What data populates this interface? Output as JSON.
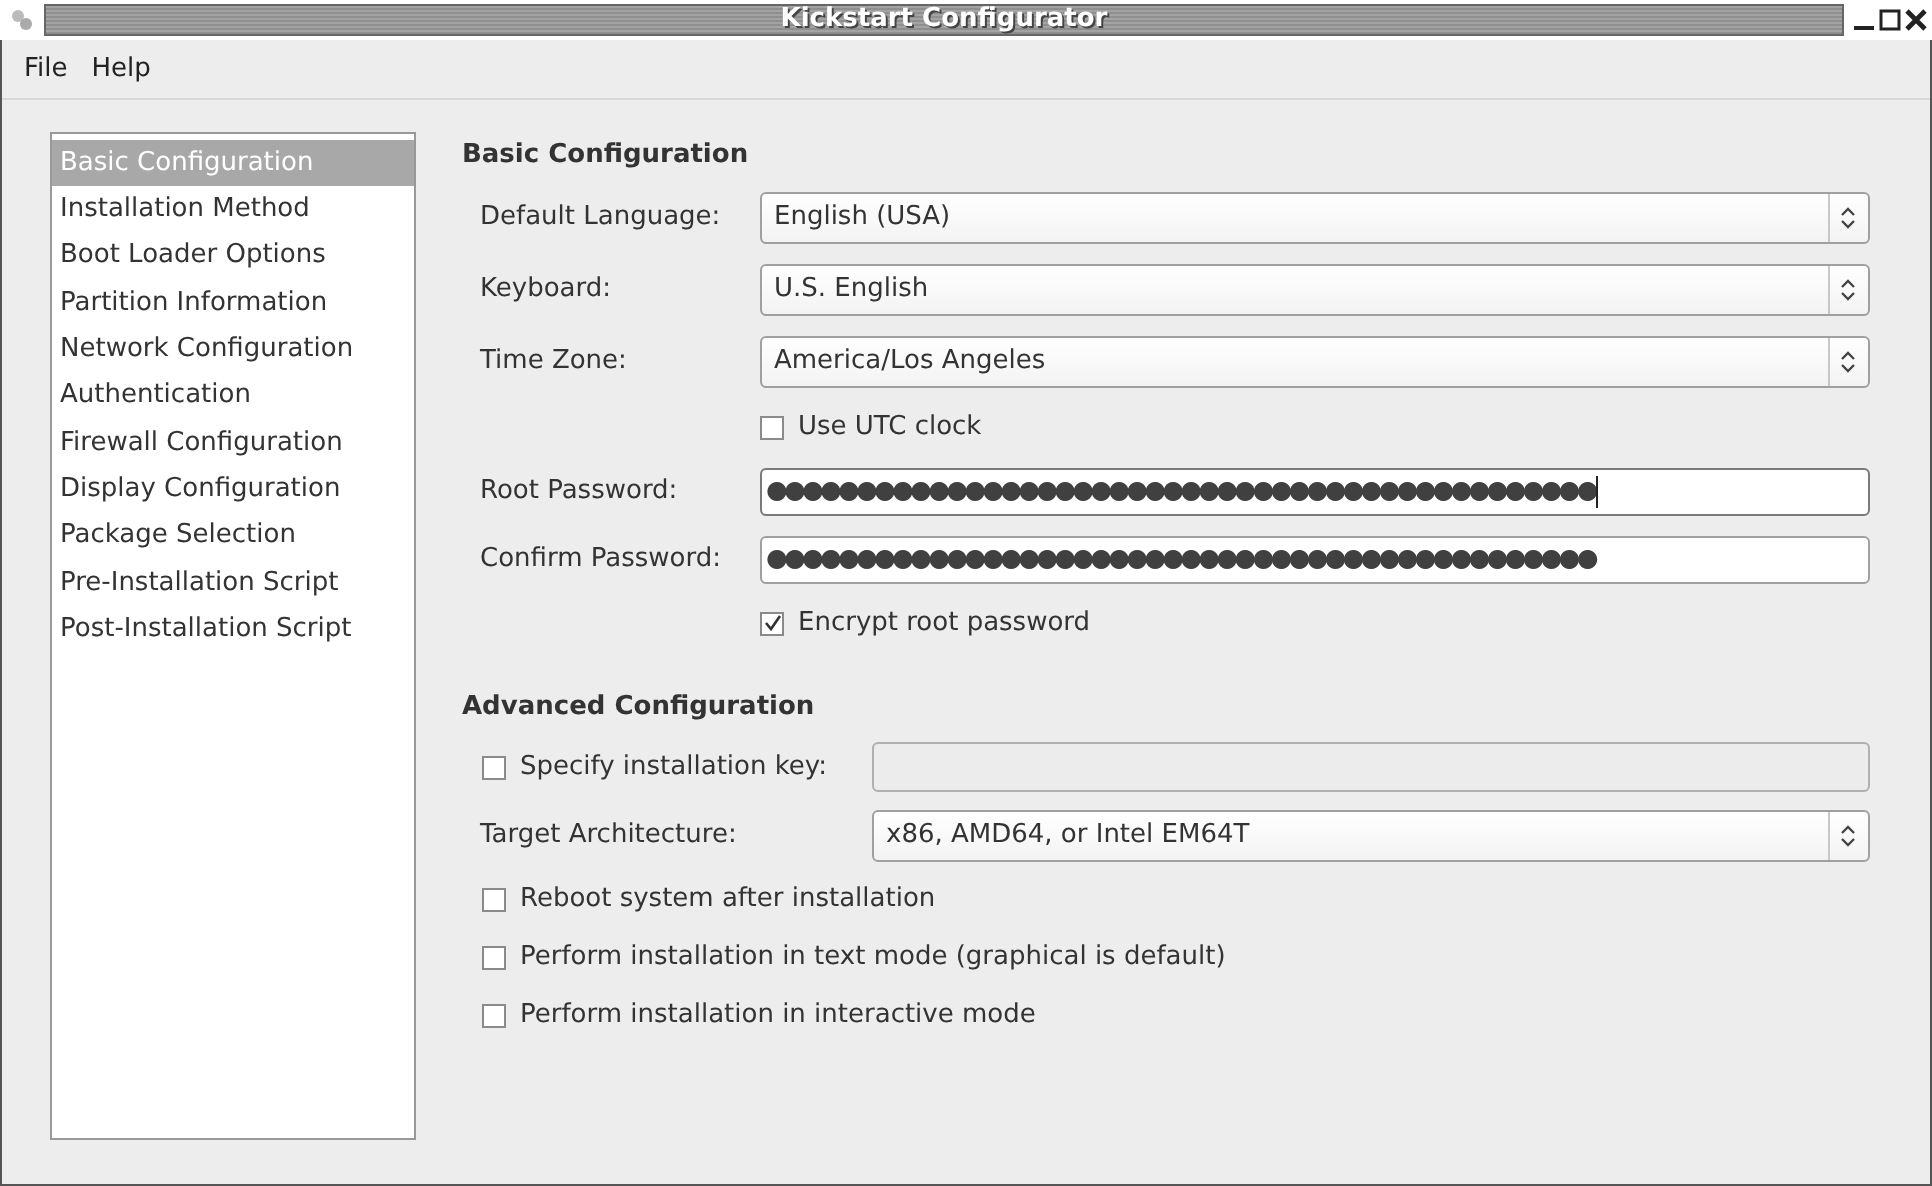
{
  "window": {
    "title": "Kickstart Configurator"
  },
  "menu": [
    "File",
    "Help"
  ],
  "sidebar": {
    "items": [
      {
        "label": "Basic Configuration",
        "selected": true
      },
      {
        "label": "Installation Method",
        "selected": false
      },
      {
        "label": "Boot Loader Options",
        "selected": false
      },
      {
        "label": "Partition Information",
        "selected": false
      },
      {
        "label": "Network Configuration",
        "selected": false
      },
      {
        "label": "Authentication",
        "selected": false
      },
      {
        "label": "Firewall Configuration",
        "selected": false
      },
      {
        "label": "Display Configuration",
        "selected": false
      },
      {
        "label": "Package Selection",
        "selected": false
      },
      {
        "label": "Pre-Installation Script",
        "selected": false
      },
      {
        "label": "Post-Installation Script",
        "selected": false
      }
    ]
  },
  "basic": {
    "heading": "Basic Configuration",
    "rows": [
      {
        "kind": "select",
        "label": "Default Language:",
        "value": "English (USA)"
      },
      {
        "kind": "select",
        "label": "Keyboard:",
        "value": "U.S. English"
      },
      {
        "kind": "select",
        "label": "Time Zone:",
        "value": "America/Los Angeles"
      },
      {
        "kind": "checkbox",
        "label": "Use UTC clock",
        "checked": false
      },
      {
        "kind": "password",
        "label": "Root Password:",
        "value": "●●●●●●●●●●●●●●●●●●●●●●●●●●●●●●●●●●●●●●●●●●●●●●",
        "focused": true
      },
      {
        "kind": "password",
        "label": "Confirm Password:",
        "value": "●●●●●●●●●●●●●●●●●●●●●●●●●●●●●●●●●●●●●●●●●●●●●●",
        "focused": false
      },
      {
        "kind": "checkbox",
        "label": "Encrypt root password",
        "checked": true
      }
    ]
  },
  "advanced": {
    "heading": "Advanced Configuration",
    "rows": [
      {
        "kind": "keyfield",
        "label": "Specify installation key:",
        "checked": false,
        "disabled": true
      },
      {
        "kind": "select",
        "label": "Target Architecture:",
        "value": "x86, AMD64, or Intel EM64T"
      },
      {
        "kind": "checkbox",
        "label": "Reboot system after installation",
        "checked": false
      },
      {
        "kind": "checkbox",
        "label": "Perform installation in text mode (graphical is default)",
        "checked": false
      },
      {
        "kind": "checkbox",
        "label": "Perform installation in interactive mode",
        "checked": false
      }
    ]
  }
}
